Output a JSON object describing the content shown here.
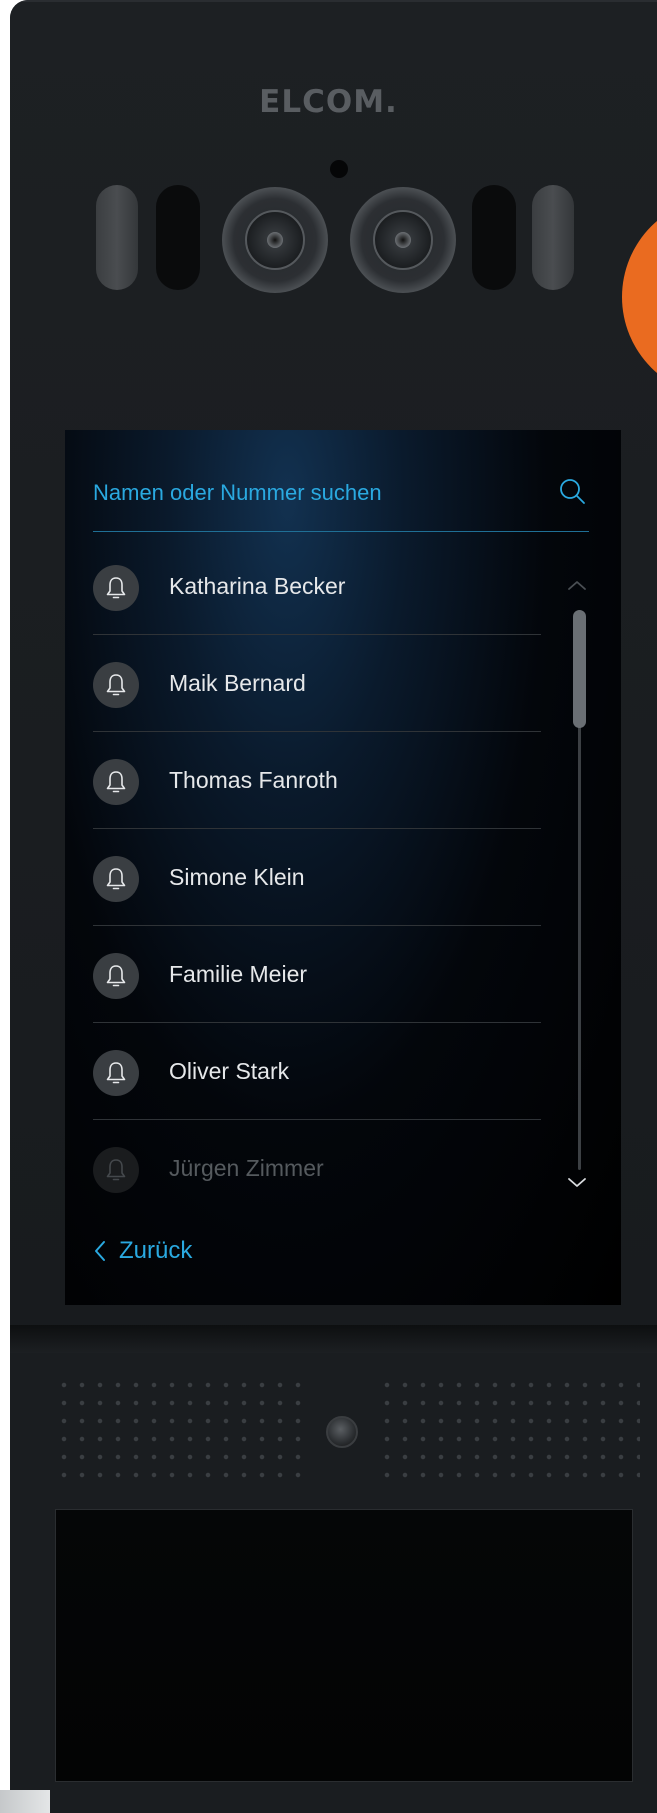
{
  "device": {
    "brand": "ELCOM."
  },
  "search": {
    "placeholder": "Namen oder Nummer suchen",
    "icon": "search-icon"
  },
  "contacts": [
    {
      "name": "Katharina Becker",
      "icon": "bell-icon",
      "faded": false
    },
    {
      "name": "Maik Bernard",
      "icon": "bell-icon",
      "faded": false
    },
    {
      "name": "Thomas Fanroth",
      "icon": "bell-icon",
      "faded": false
    },
    {
      "name": "Simone Klein",
      "icon": "bell-icon",
      "faded": false
    },
    {
      "name": "Familie Meier",
      "icon": "bell-icon",
      "faded": false
    },
    {
      "name": "Oliver Stark",
      "icon": "bell-icon",
      "faded": false
    },
    {
      "name": "Jürgen Zimmer",
      "icon": "bell-icon",
      "faded": true
    }
  ],
  "navigation": {
    "back_label": "Zurück",
    "back_icon": "chevron-left-icon"
  },
  "colors": {
    "accent": "#2aa9e0",
    "badge": "#ea6b20",
    "text": "#e6e8ea"
  }
}
